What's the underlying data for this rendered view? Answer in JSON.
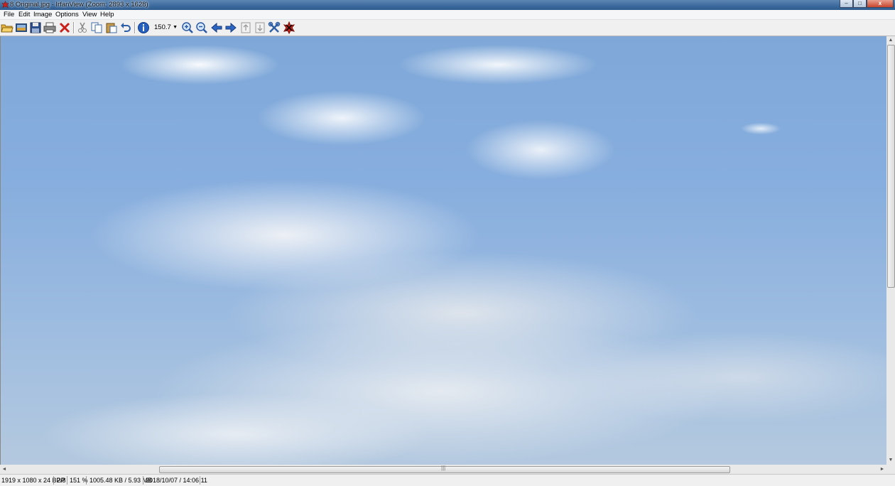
{
  "window": {
    "title": "8 Original.jpg - IrfanView (Zoom: 2893 x 1628)",
    "controls": {
      "minimize": "–",
      "maximize": "□",
      "close": "x"
    }
  },
  "menu": [
    "File",
    "Edit",
    "Image",
    "Options",
    "View",
    "Help"
  ],
  "toolbar": {
    "zoom_value": "150.7",
    "buttons": [
      "open-icon",
      "thumbnails-icon",
      "save-icon",
      "print-icon",
      "delete-icon",
      "cut-icon",
      "copy-icon",
      "paste-icon",
      "undo-icon",
      "info-icon",
      "zoom-in-icon",
      "zoom-out-icon",
      "previous-icon",
      "next-icon",
      "first-page-icon",
      "last-page-icon",
      "properties-icon",
      "exit-icon"
    ]
  },
  "scrollbars": {
    "up": "▲",
    "down": "▼",
    "left": "◄",
    "right": "►",
    "hgrip": "|||"
  },
  "status": {
    "dimensions": "1919 x 1080 x 24 BPP",
    "position": "2/8",
    "zoom": "151 %",
    "size": "1005.48 KB / 5.93 MB",
    "datetime": "2018/10/07 / 14:06:11"
  }
}
